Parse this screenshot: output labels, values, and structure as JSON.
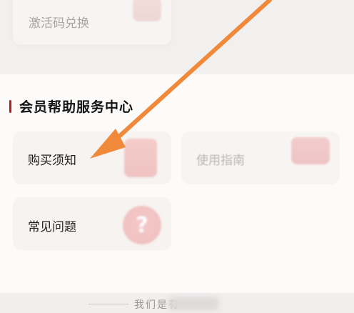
{
  "redeem": {
    "label": "激活码兑换"
  },
  "section": {
    "title": "会员帮助服务中心"
  },
  "cards": [
    {
      "label": "购买须知",
      "icon": "document-icon"
    },
    {
      "label": "使用指南",
      "icon": "guide-icon"
    },
    {
      "label": "常见问题",
      "icon": "question-icon",
      "glyph": "?"
    }
  ],
  "footer": {
    "text": "我们是有"
  },
  "colors": {
    "accent": "#b11f24",
    "annotation_arrow": "#f08a3a"
  }
}
